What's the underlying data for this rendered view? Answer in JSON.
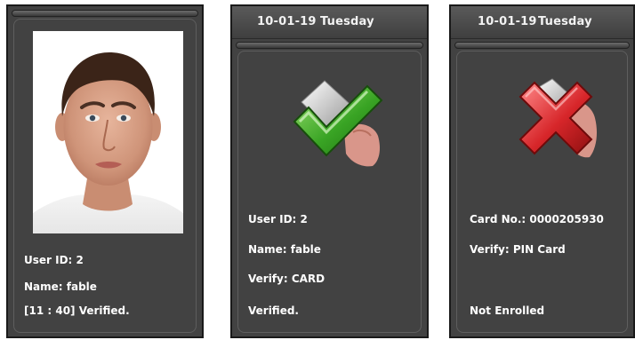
{
  "panel_verified_photo": {
    "photo_alt": "user face photo",
    "user_id": "User ID: 2",
    "name": "Name: fable",
    "status": "[11 : 40] Verified."
  },
  "panel_card_verified": {
    "date": "10-01-19",
    "weekday": "Tuesday",
    "icon": "green-check-icon",
    "user_id": "User ID: 2",
    "name": "Name: fable",
    "verify": "Verify: CARD",
    "status": "Verified."
  },
  "panel_not_enrolled": {
    "date": "10-01-19",
    "weekday": "Tuesday",
    "icon": "red-x-icon",
    "card_no": "Card No.: 0000205930",
    "verify": "Verify: PIN Card",
    "status": "Not Enrolled"
  },
  "colors": {
    "panel_bg": "#424242",
    "check_green": "#3fae2a",
    "cross_red": "#d7262a",
    "text": "#ffffff"
  }
}
